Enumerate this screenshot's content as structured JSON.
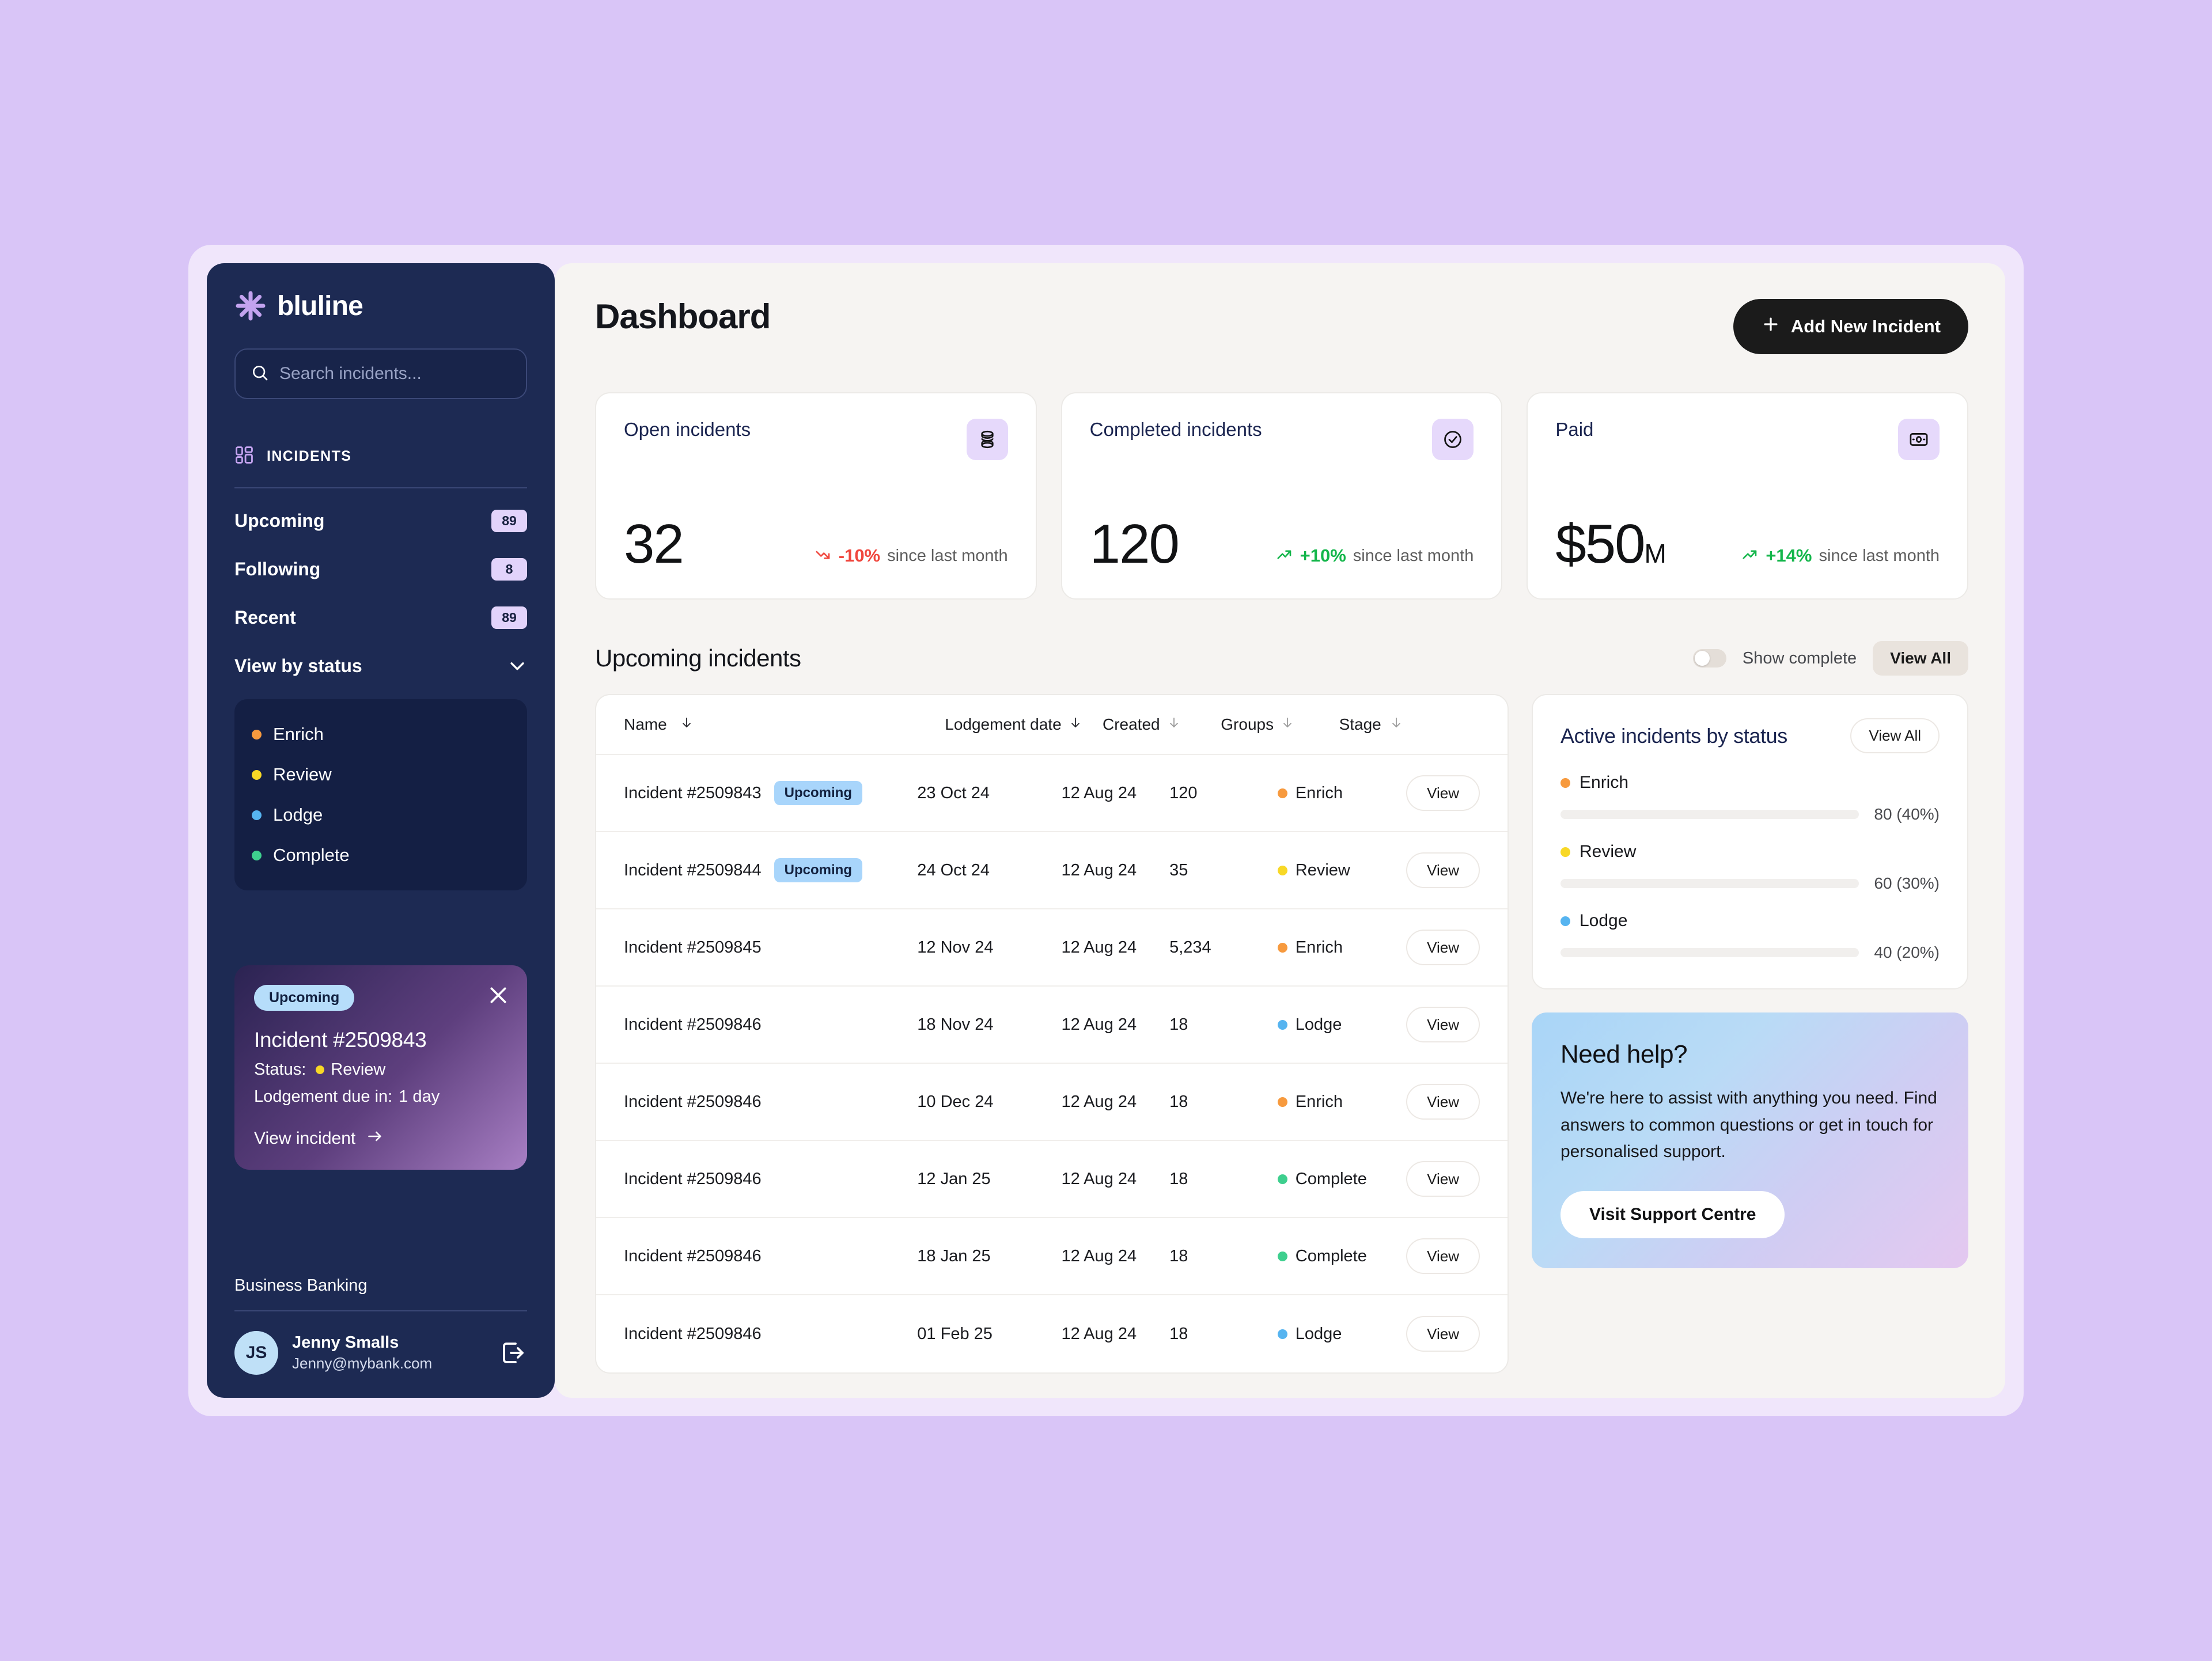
{
  "theme": {
    "page_bg": "#d9c5f7",
    "window_bg": "#f0e6fb",
    "sidebar_bg": "#1d2a53",
    "main_bg": "#f6f4f2",
    "accent_purple": "#c3a3ef",
    "enrich_color": "#f79a3e",
    "review_color": "#f8d826",
    "lodge_color": "#56b4f0",
    "complete_color": "#3ecf8e",
    "up_color": "#14b64b",
    "down_color": "#f0473e"
  },
  "sidebar": {
    "brand": "bluline",
    "search": {
      "placeholder": "Search incidents...",
      "value": ""
    },
    "section": {
      "label": "INCIDENTS"
    },
    "nav_items": [
      {
        "label": "Upcoming",
        "badge": "89"
      },
      {
        "label": "Following",
        "badge": "8"
      },
      {
        "label": "Recent",
        "badge": "89"
      }
    ],
    "view_by_status": {
      "label": "View by status"
    },
    "statuses": [
      {
        "label": "Enrich",
        "color": "#f79a3e"
      },
      {
        "label": "Review",
        "color": "#f8d826"
      },
      {
        "label": "Lodge",
        "color": "#56b4f0"
      },
      {
        "label": "Complete",
        "color": "#3ecf8e"
      }
    ],
    "notification": {
      "pill": "Upcoming",
      "title": "Incident #2509843",
      "status_label": "Status:",
      "status_value": "Review",
      "status_color": "#f8d826",
      "due_label": "Lodgement due in:",
      "due_value": "1 day",
      "link": "View incident"
    },
    "footer": {
      "org": "Business Banking",
      "user_initials": "JS",
      "user_name": "Jenny Smalls",
      "user_email": "Jenny@mybank.com"
    }
  },
  "header": {
    "title": "Dashboard",
    "add_button": "Add New Incident"
  },
  "stats": [
    {
      "label": "Open incidents",
      "value": "32",
      "suffix": "",
      "icon": "database-icon",
      "trend_pct": "-10%",
      "trend_since": "since last month",
      "direction": "down"
    },
    {
      "label": "Completed incidents",
      "value": "120",
      "suffix": "",
      "icon": "check-circle-icon",
      "trend_pct": "+10%",
      "trend_since": "since last month",
      "direction": "up"
    },
    {
      "label": "Paid",
      "value": "$50",
      "suffix": "M",
      "icon": "money-icon",
      "trend_pct": "+14%",
      "trend_since": "since last month",
      "direction": "up"
    }
  ],
  "incidents_section": {
    "title": "Upcoming incidents",
    "toggle_label": "Show complete",
    "toggle_on": false,
    "view_all": "View All",
    "columns": [
      "Name",
      "Lodgement date",
      "Created",
      "Groups",
      "Stage"
    ],
    "rows": [
      {
        "name": "Incident #2509843",
        "chip": "Upcoming",
        "lodgement": "23 Oct 24",
        "created": "12 Aug 24",
        "groups": "120",
        "stage": "Enrich",
        "stage_color": "#f79a3e",
        "action": "View"
      },
      {
        "name": "Incident #2509844",
        "chip": "Upcoming",
        "lodgement": "24 Oct 24",
        "created": "12 Aug 24",
        "groups": "35",
        "stage": "Review",
        "stage_color": "#f8d826",
        "action": "View"
      },
      {
        "name": "Incident #2509845",
        "chip": "",
        "lodgement": "12 Nov 24",
        "created": "12 Aug 24",
        "groups": "5,234",
        "stage": "Enrich",
        "stage_color": "#f79a3e",
        "action": "View"
      },
      {
        "name": "Incident #2509846",
        "chip": "",
        "lodgement": "18 Nov 24",
        "created": "12 Aug 24",
        "groups": "18",
        "stage": "Lodge",
        "stage_color": "#56b4f0",
        "action": "View"
      },
      {
        "name": "Incident #2509846",
        "chip": "",
        "lodgement": "10 Dec 24",
        "created": "12 Aug 24",
        "groups": "18",
        "stage": "Enrich",
        "stage_color": "#f79a3e",
        "action": "View"
      },
      {
        "name": "Incident #2509846",
        "chip": "",
        "lodgement": "12 Jan 25",
        "created": "12 Aug 24",
        "groups": "18",
        "stage": "Complete",
        "stage_color": "#3ecf8e",
        "action": "View"
      },
      {
        "name": "Incident #2509846",
        "chip": "",
        "lodgement": "18 Jan 25",
        "created": "12 Aug 24",
        "groups": "18",
        "stage": "Complete",
        "stage_color": "#3ecf8e",
        "action": "View"
      },
      {
        "name": "Incident #2509846",
        "chip": "",
        "lodgement": "01 Feb 25",
        "created": "12 Aug 24",
        "groups": "18",
        "stage": "Lodge",
        "stage_color": "#56b4f0",
        "action": "View"
      }
    ]
  },
  "status_panel": {
    "title": "Active incidents by status",
    "view_all": "View All",
    "bars": [
      {
        "label": "Enrich",
        "color": "#f79a3e",
        "percent": 40,
        "value_text": "80 (40%)"
      },
      {
        "label": "Review",
        "color": "#f8d826",
        "percent": 30,
        "value_text": "60 (30%)"
      },
      {
        "label": "Lodge",
        "color": "#56b4f0",
        "percent": 20,
        "value_text": "40 (20%)"
      }
    ]
  },
  "help_card": {
    "title": "Need help?",
    "body": "We're here to assist with anything you need. Find answers to common questions or get in touch for personalised support.",
    "button": "Visit Support Centre"
  },
  "chart_data": {
    "type": "bar",
    "title": "Active incidents by status",
    "categories": [
      "Enrich",
      "Review",
      "Lodge"
    ],
    "values": [
      80,
      60,
      40
    ],
    "percentages": [
      40,
      30,
      20
    ],
    "colors": [
      "#f79a3e",
      "#f8d826",
      "#56b4f0"
    ],
    "xlabel": "",
    "ylabel": "",
    "orientation": "horizontal",
    "grid": false,
    "legend": "inline-labels"
  }
}
